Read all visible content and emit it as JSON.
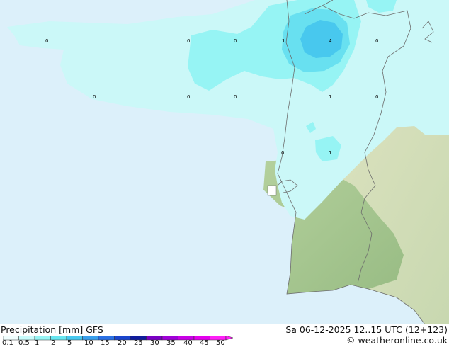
{
  "map": {
    "point_values": [
      "0",
      "0",
      "0",
      "1",
      "4",
      "0",
      "0",
      "0",
      "0",
      "1",
      "0",
      "0",
      "1"
    ]
  },
  "footer": {
    "title": "Precipitation [mm] GFS",
    "datetime": "Sa 06-12-2025 12..15 UTC (12+123)",
    "credit": "© weatheronline.co.uk",
    "scale_labels": [
      "0.1",
      "0.5",
      "1",
      "2",
      "5",
      "10",
      "15",
      "20",
      "25",
      "30",
      "35",
      "40",
      "45",
      "50"
    ],
    "scale_colors": [
      "#f0fefe",
      "#c8fbfb",
      "#96f4f4",
      "#68e6f0",
      "#48c8ee",
      "#3aa0ec",
      "#2a70e4",
      "#1a44cc",
      "#101c9c",
      "#7a00c4",
      "#a000d8",
      "#c800e6",
      "#e400ee",
      "#ff20f8"
    ]
  },
  "colors": {
    "sea": "#dcf0fa",
    "land_green": "#a8c890",
    "land_tan": "#e8dcb4",
    "precip_light": "#cbf8f8",
    "precip_mid": "#96f4f4",
    "precip_strong": "#68e0f0",
    "precip_max": "#48c8ee"
  }
}
